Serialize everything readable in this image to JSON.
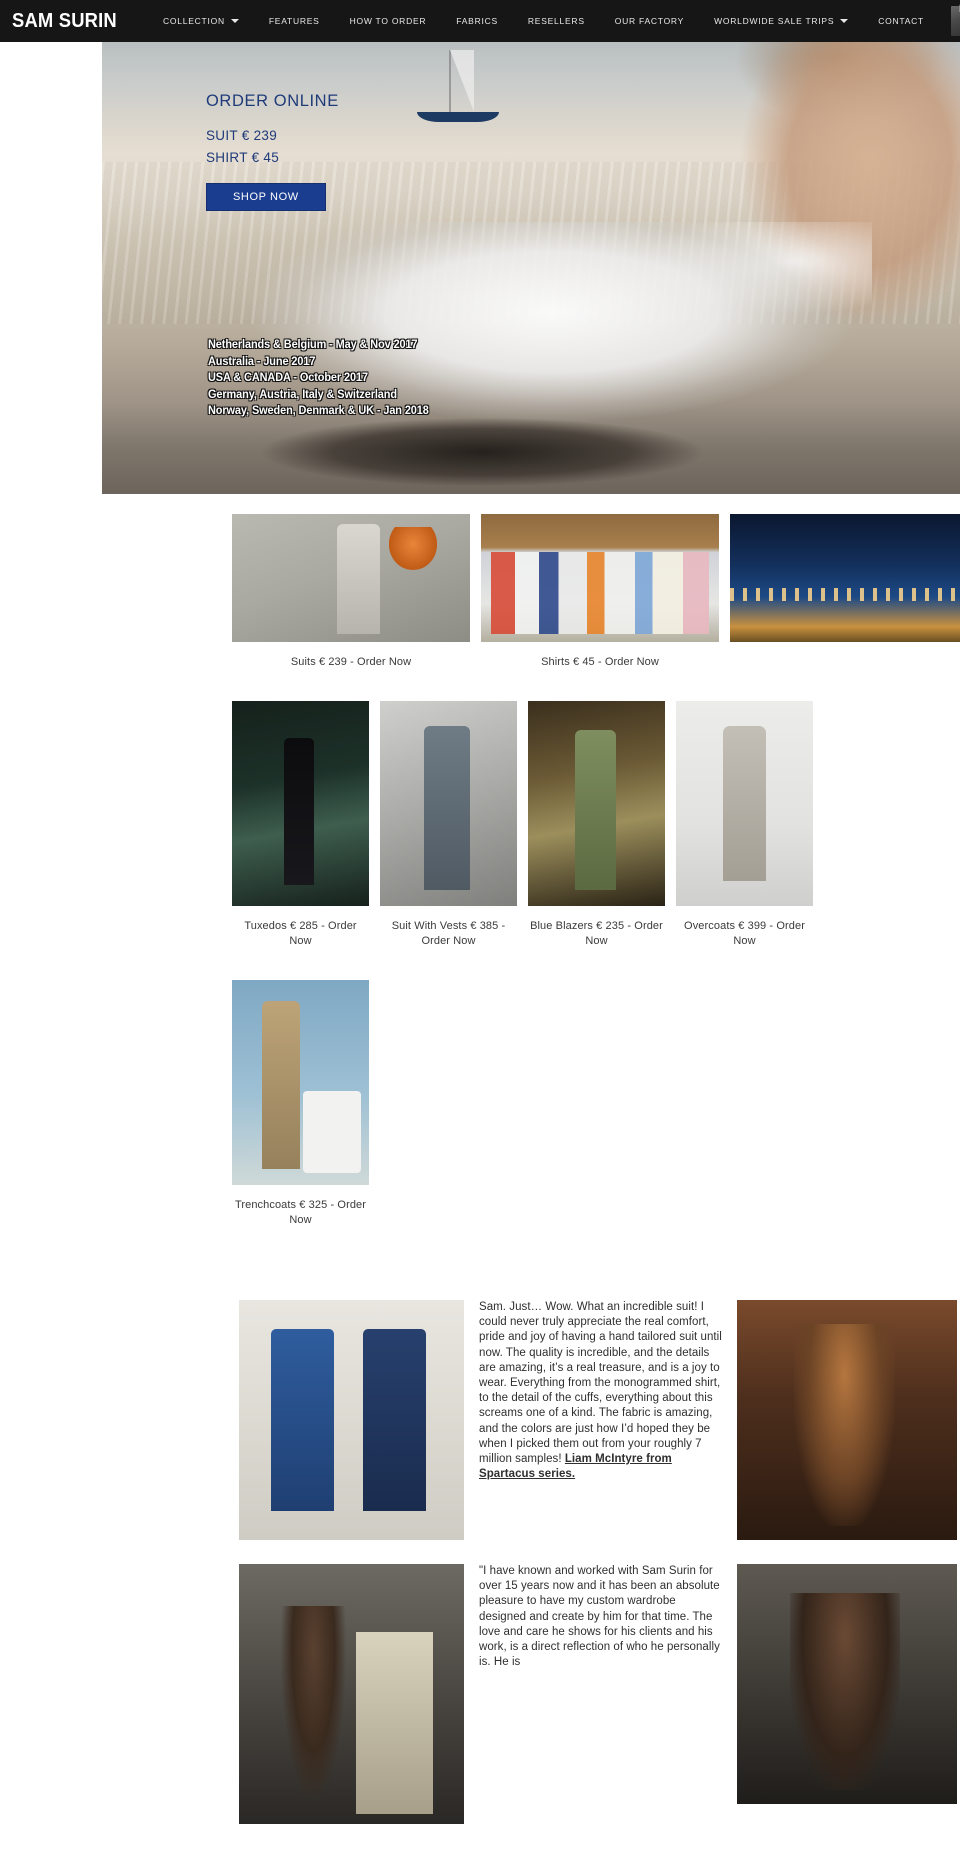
{
  "header": {
    "brand": "SAM SURIN",
    "nav": [
      {
        "label": "COLLECTION",
        "has_caret": true
      },
      {
        "label": "FEATURES",
        "has_caret": false
      },
      {
        "label": "HOW TO ORDER",
        "has_caret": false
      },
      {
        "label": "FABRICS",
        "has_caret": false
      },
      {
        "label": "RESELLERS",
        "has_caret": false
      },
      {
        "label": "OUR FACTORY",
        "has_caret": false
      },
      {
        "label": "WORLDWIDE SALE TRIPS",
        "has_caret": true
      },
      {
        "label": "CONTACT",
        "has_caret": false
      }
    ],
    "cart_icon": "shopping-bag-icon",
    "background": "#161616"
  },
  "hero": {
    "title": "ORDER ONLINE",
    "price_suit": "SUIT € 239",
    "price_shirt": "SHIRT € 45",
    "cta": "SHOP NOW",
    "accent_color": "#1f3b7a",
    "button_color": "#1a3d8f",
    "trips": [
      "Netherlands & Belgium - May & Nov 2017",
      "Australia - June 2017",
      "USA & CANADA  -  October 2017",
      "Germany, Austria, Italy & Switzerland",
      "Norway, Sweden, Denmark & UK - Jan 2018"
    ]
  },
  "products": {
    "row1": [
      {
        "caption": "Suits € 239 - Order Now",
        "art": "img-suits"
      },
      {
        "caption": "Shirts € 45 - Order Now",
        "art": "img-shirts"
      },
      {
        "caption": "",
        "art": "img-night"
      }
    ],
    "row2": [
      {
        "caption": "Tuxedos € 285 - Order Now",
        "art": "img-tux"
      },
      {
        "caption": "Suit With Vests € 385 - Order Now",
        "art": "img-vest"
      },
      {
        "caption": "Blue Blazers € 235 - Order Now",
        "art": "img-blazer"
      },
      {
        "caption": "Overcoats € 399 - Order Now",
        "art": "img-coat"
      }
    ],
    "row3": [
      {
        "caption": "Trenchcoats € 325 - Order Now",
        "art": "img-trench"
      }
    ]
  },
  "testimonials": [
    {
      "photo": "photo-twins",
      "text": "Sam. Just… Wow. What an incredible suit! I could never truly appreciate the real comfort, pride and joy of having a hand tailored suit until now. The quality is incredible, and the details are amazing, it’s a real treasure, and is a joy to wear. Everything from the monogrammed shirt, to the detail of the cuffs, everything about this screams one of a kind. The fabric is amazing, and the colors are just how I’d hoped they be when I picked them out from your roughly 7 million samples! ",
      "attribution": "Liam McIntyre from Spartacus series.",
      "side": "side-warrior"
    },
    {
      "photo": "photo-group",
      "text": "\"I have known and worked with Sam Surin for over 15 years now and it has been an absolute pleasure to have my custom wardrobe designed and create by him for that time. The love and care he shows for his clients and his work, is a direct reflection of who he personally is. He is",
      "attribution": "",
      "side": "side-man"
    }
  ]
}
